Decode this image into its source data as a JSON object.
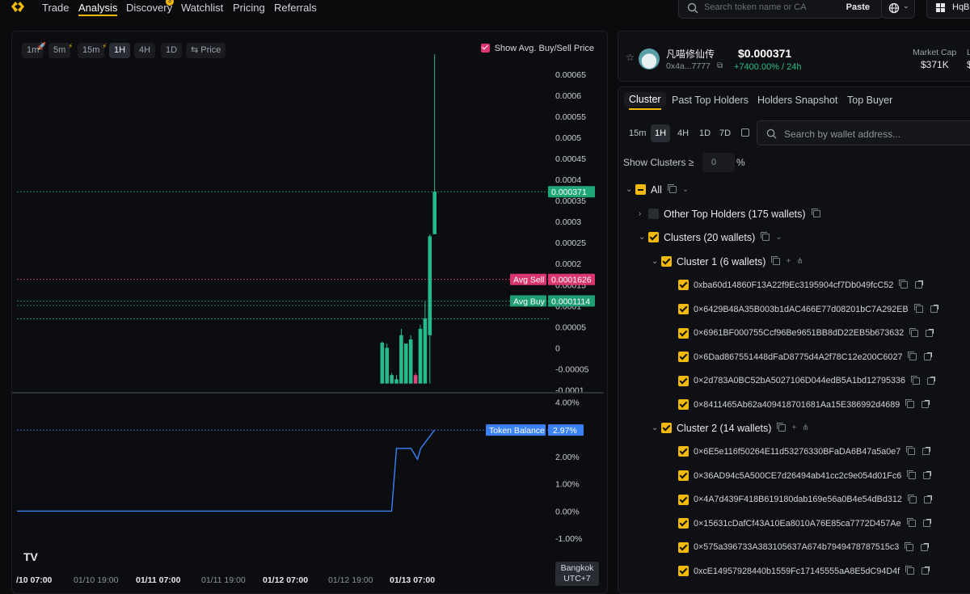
{
  "nav": {
    "items": [
      "Trade",
      "Analysis",
      "Discovery",
      "Watchlist",
      "Pricing",
      "Referrals"
    ],
    "active": "Analysis",
    "discovery_badge": "3",
    "search_placeholder": "Search token name or CA",
    "paste_label": "Paste",
    "user_label": "HqB"
  },
  "chart": {
    "timeframes": [
      "1m",
      "5m",
      "15m",
      "1H",
      "4H",
      "1D"
    ],
    "active_timeframe": "1H",
    "price_toggle": "Price",
    "show_avg_label": "Show Avg. Buy/Sell Price",
    "show_avg_checked": true,
    "timezone_line1": "Bangkok",
    "timezone_line2": "UTC+7",
    "logo_text": "TV",
    "colors": {
      "up": "#26b98a",
      "down": "#e0447e",
      "balance": "#3b82f6",
      "sell_tag": "#d9356f",
      "buy_tag": "#1f9e74",
      "price_tag": "#1fa877"
    }
  },
  "chart_data": [
    {
      "type": "candlestick",
      "title": "",
      "y_ticks": [
        "0.00065",
        "0.0006",
        "0.00055",
        "0.0005",
        "0.00045",
        "0.0004",
        "0.00035",
        "0.0003",
        "0.00025",
        "0.0002",
        "0.00015",
        "0.0001",
        "0.00005",
        "0",
        "-0.00005",
        "-0.0001"
      ],
      "ylim": [
        -0.000105,
        0.000698
      ],
      "x_ticks": [
        "/10 07:00",
        "01/10 19:00",
        "01/11 07:00",
        "01/11 19:00",
        "01/12 07:00",
        "01/12 19:00",
        "01/13 07:00"
      ],
      "x_ticks_bold": [
        true,
        false,
        true,
        false,
        true,
        false,
        true
      ],
      "current_price": "0.000371",
      "avg_sell": {
        "label": "Avg Sell",
        "value": "0.0001626"
      },
      "avg_buy": {
        "label": "Avg Buy",
        "value": "0.0001114"
      },
      "extra_levels": [
        0.0001005,
        6.9e-05
      ],
      "candles": [
        {
          "o": -8.5e-05,
          "h": 1.5e-05,
          "l": -8.5e-05,
          "c": 1.2e-05,
          "up": true
        },
        {
          "o": 0.0,
          "h": 1e-05,
          "l": -8.5e-05,
          "c": -8.5e-05,
          "up": true
        },
        {
          "o": -8.5e-05,
          "h": -6e-05,
          "l": -8.5e-05,
          "c": -6.5e-05,
          "up": true
        },
        {
          "o": -8.5e-05,
          "h": -6.5e-05,
          "l": -8.5e-05,
          "c": -7.5e-05,
          "up": true
        },
        {
          "o": -8.5e-05,
          "h": 4.5e-05,
          "l": -8.5e-05,
          "c": 3e-05,
          "up": true
        },
        {
          "o": -8.5e-05,
          "h": 1e-05,
          "l": -8.5e-05,
          "c": 1e-05,
          "up": true
        },
        {
          "o": -8.5e-05,
          "h": 3e-05,
          "l": -8.5e-05,
          "c": 2e-05,
          "up": true
        },
        {
          "o": -6.5e-05,
          "h": -6e-05,
          "l": -8.5e-05,
          "c": -8.5e-05,
          "up": false
        },
        {
          "o": -8.5e-05,
          "h": 5.5e-05,
          "l": -8.5e-05,
          "c": 4.5e-05,
          "up": true
        },
        {
          "o": -8.5e-05,
          "h": 0.00011,
          "l": -8.5e-05,
          "c": 7e-05,
          "up": true
        },
        {
          "o": 3e-05,
          "h": 0.00027,
          "l": -8.5e-05,
          "c": 0.000265,
          "up": true
        },
        {
          "o": 0.00027,
          "h": 0.000698,
          "l": 0.00027,
          "c": 0.000371,
          "up": true
        }
      ]
    },
    {
      "type": "line",
      "series": [
        {
          "name": "Token Balance",
          "last_label": "2.97%",
          "values": [
            0,
            0,
            0,
            0,
            0,
            0,
            0,
            0,
            0,
            2.3,
            2.3,
            2.97
          ]
        }
      ],
      "y_ticks": [
        "4.00%",
        "3.00%",
        "2.00%",
        "1.00%",
        "0.00%",
        "-1.00%"
      ],
      "ylim": [
        -1.2,
        4.1
      ]
    }
  ],
  "token": {
    "name": "凡喵修仙传",
    "address": "0x4a...7777",
    "price": "$0.000371",
    "change": "+7400.00% / 24h",
    "market_cap_label": "Market Cap",
    "market_cap_value": "$371K",
    "liq_label": "L",
    "liq_value": "$"
  },
  "clusters": {
    "tabs": [
      "Cluster",
      "Past Top Holders",
      "Holders Snapshot",
      "Top Buyer"
    ],
    "active_tab": "Cluster",
    "timeframes": [
      "15m",
      "1H",
      "4H",
      "1D",
      "7D"
    ],
    "active_timeframe": "1H",
    "search_placeholder": "Search by wallet address...",
    "show_clusters_label": "Show Clusters ≥",
    "threshold_value": "0",
    "threshold_unit": "%",
    "all_label": "All",
    "other_label": "Other Top Holders (175 wallets)",
    "clusters_label": "Clusters (20 wallets)",
    "cluster1_label": "Cluster 1 (6 wallets)",
    "cluster1_wallets": [
      "0xba60d14860F13A22f9Ec3195904cf7Db049fcC52",
      "0×6429B48A35B003b1dAC466E77d08201bC7A292EB",
      "0×6961BF000755Ccf96Be9651BB8dD22EB5b673632",
      "0×6Dad867551448dFaD8775d4A2f78C12e200C6027",
      "0×2d783A0BC52bA5027106D044edB5A1bd12795336",
      "0×8411465Ab62a409418701681Aa15E386992d4689"
    ],
    "cluster2_label": "Cluster 2 (14 wallets)",
    "cluster2_wallets": [
      "0×6E5e116f50264E11d53276330BFaDA6B47a5a0e7",
      "0×36AD94c5A500CE7d26494ab41cc2c9e054d01Fc6",
      "0×4A7d439F418B619180dab169e56a0B4e54dBd312",
      "0×15631cDafCf43A10Ea8010A76E85ca7772D457Ae",
      "0×575a396733A383105637A674b7949478787515c3",
      "0xcE14957928440b1559Fc17145555aA8E5dC94D4f"
    ]
  }
}
